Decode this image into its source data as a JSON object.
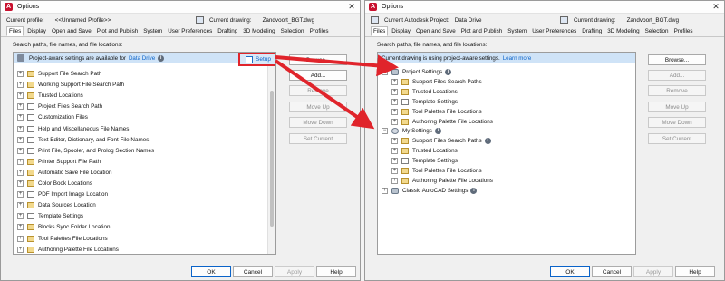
{
  "left_dialog": {
    "title": "Options",
    "app_icon_letter": "A",
    "profile_label": "Current profile:",
    "profile_value": "<<Unnamed Profile>>",
    "drawing_label": "Current drawing:",
    "drawing_value": "Zandvoort_BGT.dwg",
    "tabs": [
      "Files",
      "Display",
      "Open and Save",
      "Plot and Publish",
      "System",
      "User Preferences",
      "Drafting",
      "3D Modeling",
      "Selection",
      "Profiles"
    ],
    "search_label": "Search paths, file names, and file locations:",
    "banner_text": "Project-aware settings are available for",
    "banner_link": "Data Drive",
    "setup_label": "Setup",
    "tree": [
      {
        "label": "Support File Search Path",
        "icon": "folder-icon"
      },
      {
        "label": "Working Support File Search Path",
        "icon": "folder-icon"
      },
      {
        "label": "Trusted Locations",
        "icon": "folder-icon"
      },
      {
        "label": "Project Files Search Path",
        "icon": "doc-icon"
      },
      {
        "label": "Customization Files",
        "icon": "doc-icon"
      },
      {
        "label": "Help and Miscellaneous File Names",
        "icon": "doc-icon"
      },
      {
        "label": "Text Editor, Dictionary, and Font File Names",
        "icon": "doc-icon"
      },
      {
        "label": "Print File, Spooler, and Prolog Section Names",
        "icon": "doc-icon"
      },
      {
        "label": "Printer Support File Path",
        "icon": "folder-icon"
      },
      {
        "label": "Automatic Save File Location",
        "icon": "folder-icon"
      },
      {
        "label": "Color Book Locations",
        "icon": "folder-icon"
      },
      {
        "label": "PDF Import Image Location",
        "icon": "doc-icon"
      },
      {
        "label": "Data Sources Location",
        "icon": "folder-icon"
      },
      {
        "label": "Template Settings",
        "icon": "doc-icon"
      },
      {
        "label": "Blocks Sync Folder Location",
        "icon": "folder-icon"
      },
      {
        "label": "Tool Palettes File Locations",
        "icon": "folder-icon"
      },
      {
        "label": "Authoring Palette File Locations",
        "icon": "folder-icon"
      }
    ],
    "side_buttons": [
      "Browse...",
      "Add...",
      "Remove",
      "Move Up",
      "Move Down",
      "Set Current"
    ],
    "bottom_buttons": [
      "OK",
      "Cancel",
      "Apply",
      "Help"
    ]
  },
  "right_dialog": {
    "title": "Options",
    "app_icon_letter": "A",
    "project_label": "Current Autodesk Project:",
    "project_value": "Data Drive",
    "drawing_label": "Current drawing:",
    "drawing_value": "Zandvoort_BGT.dwg",
    "tabs": [
      "Files",
      "Display",
      "Open and Save",
      "Plot and Publish",
      "System",
      "User Preferences",
      "Drafting",
      "3D Modeling",
      "Selection",
      "Profiles"
    ],
    "search_label": "Search paths, file names, and file locations:",
    "banner_text": "Current drawing is using project-aware settings.",
    "banner_link": "Learn more",
    "tree": [
      {
        "label": "Project Settings",
        "icon": "gear-icon",
        "level": 0,
        "expander": "−",
        "info": true
      },
      {
        "label": "Support Files Search Paths",
        "icon": "folder-icon",
        "level": 1,
        "expander": "+",
        "info": false
      },
      {
        "label": "Trusted Locations",
        "icon": "folder-icon",
        "level": 1,
        "expander": "+",
        "info": false
      },
      {
        "label": "Template Settings",
        "icon": "doc-icon",
        "level": 1,
        "expander": "+",
        "info": false
      },
      {
        "label": "Tool Palettes File Locations",
        "icon": "folder-icon",
        "level": 1,
        "expander": "+",
        "info": false
      },
      {
        "label": "Authoring Palette File Locations",
        "icon": "folder-icon",
        "level": 1,
        "expander": "+",
        "info": false
      },
      {
        "label": "My Settings",
        "icon": "person-icon",
        "level": 0,
        "expander": "−",
        "info": true
      },
      {
        "label": "Support Files Search Paths",
        "icon": "folder-icon",
        "level": 1,
        "expander": "+",
        "info": true
      },
      {
        "label": "Trusted Locations",
        "icon": "folder-icon",
        "level": 1,
        "expander": "+",
        "info": false
      },
      {
        "label": "Template Settings",
        "icon": "doc-icon",
        "level": 1,
        "expander": "+",
        "info": false
      },
      {
        "label": "Tool Palettes File Locations",
        "icon": "folder-icon",
        "level": 1,
        "expander": "+",
        "info": false
      },
      {
        "label": "Authoring Palette File Locations",
        "icon": "folder-icon",
        "level": 1,
        "expander": "+",
        "info": false
      },
      {
        "label": "Classic AutoCAD Settings",
        "icon": "gear-icon",
        "level": 0,
        "expander": "+",
        "info": true
      }
    ],
    "side_buttons": [
      "Browse...",
      "Add...",
      "Remove",
      "Move Up",
      "Move Down",
      "Set Current"
    ],
    "bottom_buttons": [
      "OK",
      "Cancel",
      "Apply",
      "Help"
    ]
  },
  "colors": {
    "accent": "#0a63c9",
    "highlight_red": "#e0242b",
    "banner_bg": "#cfe3f7"
  }
}
